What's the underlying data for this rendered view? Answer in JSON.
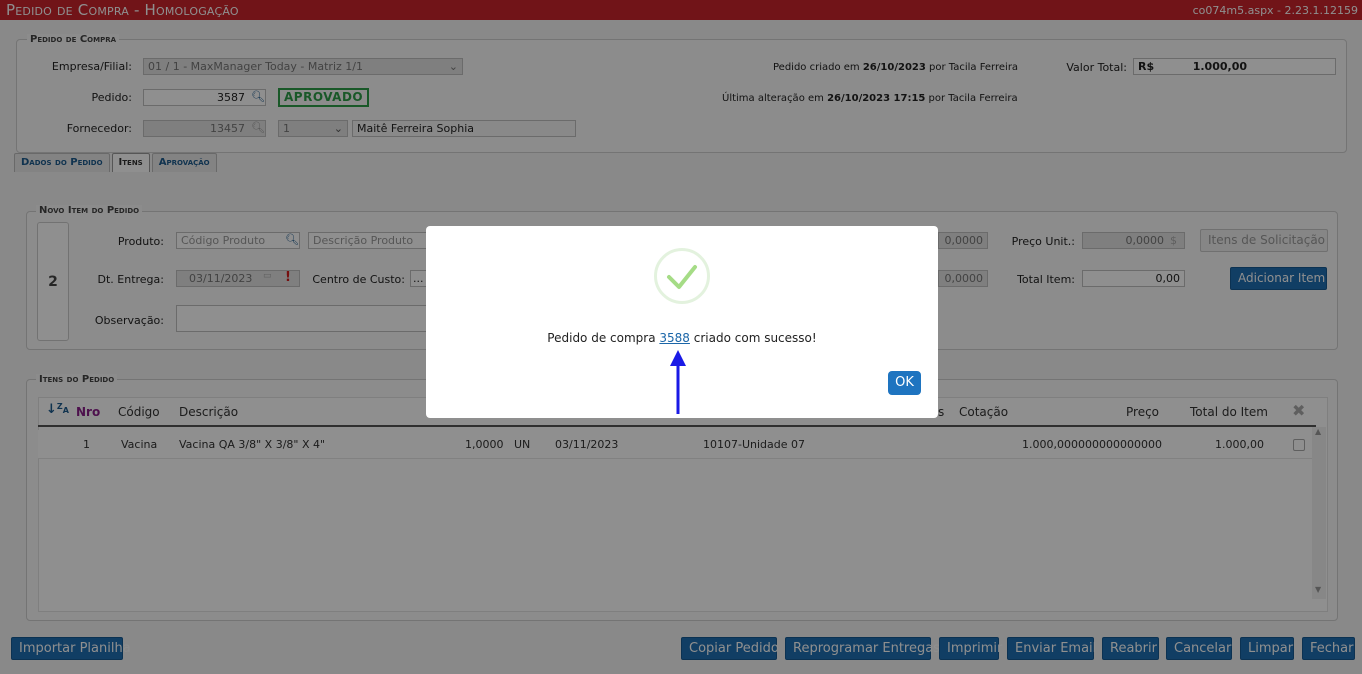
{
  "header": {
    "title": "Pedido de Compra - Homologação",
    "version": "co074m5.aspx - 2.23.1.12159"
  },
  "purchase": {
    "legend": "Pedido de Compra",
    "empresa_label": "Empresa/Filial:",
    "empresa_value": "01 / 1 - MaxManager Today - Matriz 1/1",
    "pedido_label": "Pedido:",
    "pedido_value": "3587",
    "status": "APROVADO",
    "fornecedor_label": "Fornecedor:",
    "fornecedor_code": "13457",
    "fornecedor_seq": "1",
    "fornecedor_name": "Maitê Ferreira Sophia",
    "criado_prefix": "Pedido criado em",
    "criado_date": "26/10/2023",
    "criado_by": "por Tacila Ferreira",
    "alterado_prefix": "Última alteração em",
    "alterado_date": "26/10/2023 17:15",
    "alterado_by": "por Tacila Ferreira",
    "valor_label": "Valor Total:",
    "valor_currency": "R$",
    "valor_value": "1.000,00"
  },
  "tabs": [
    {
      "label": "Dados do Pedido"
    },
    {
      "label": "Itens"
    },
    {
      "label": "Aprovação"
    }
  ],
  "novo_item": {
    "legend": "Novo Item do Pedido",
    "seq": "2",
    "produto_label": "Produto:",
    "produto_code_ph": "Código Produto",
    "produto_desc_ph": "Descrição Produto",
    "qtd_value": "0,0000",
    "preco_label": "Preço Unit.:",
    "preco_value": "0,0000",
    "preco_currency": "$",
    "itens_solic_button": "Itens de Solicitação",
    "dt_entrega_label": "Dt. Entrega:",
    "dt_entrega_value": "03/11/2023",
    "centro_label": "Centro de Custo:",
    "centro_value": "...",
    "desc_value": "0,0000",
    "total_label": "Total Item:",
    "total_value": "0,00",
    "add_button": "Adicionar Item",
    "obs_label": "Observação:"
  },
  "itens": {
    "legend": "Itens do Pedido",
    "columns": {
      "nro": "Nro",
      "codigo": "Código",
      "descricao": "Descrição",
      "obs": "s",
      "cotacao": "Cotação",
      "preco": "Preço",
      "total": "Total do Item"
    },
    "rows": [
      {
        "nro": "1",
        "codigo": "Vacina",
        "descricao": "Vacina QA 3/8\" X 3/8\" X 4\"",
        "qtd": "1,0000",
        "un": "UN",
        "data": "03/11/2023",
        "centro": "10107-Unidade 07",
        "preco": "1.000,000000000000000",
        "total": "1.000,00"
      }
    ]
  },
  "footer": {
    "importar": "Importar Planilha",
    "copiar": "Copiar Pedido",
    "reprogramar": "Reprogramar Entregas",
    "imprimir": "Imprimir",
    "enviar": "Enviar Email",
    "reabrir": "Reabrir",
    "cancelar": "Cancelar",
    "limpar": "Limpar",
    "fechar": "Fechar"
  },
  "modal": {
    "msg_prefix": "Pedido de compra",
    "order_link": "3588",
    "msg_suffix": "criado com sucesso!",
    "ok": "OK"
  },
  "colors": {
    "header_red": "#c9252c",
    "button_blue": "#1f6fb2",
    "success_green": "#2e9e48",
    "arrow_blue": "#1a1ae6"
  }
}
